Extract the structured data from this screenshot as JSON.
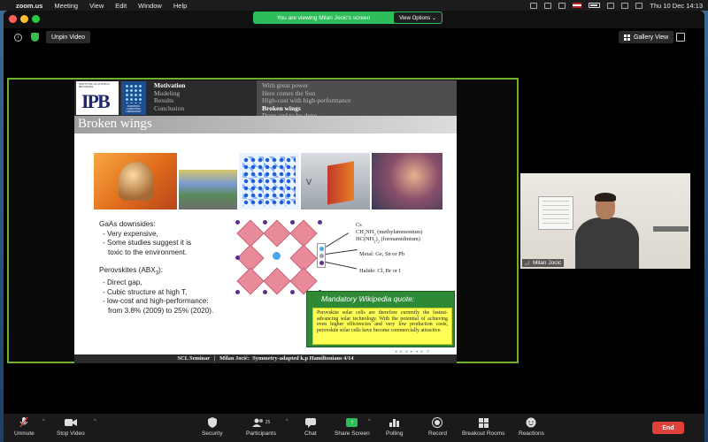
{
  "menubar": {
    "app": "zoom.us",
    "items": [
      "Meeting",
      "View",
      "Edit",
      "Window",
      "Help"
    ],
    "clock": "Thu 10 Dec  14:13"
  },
  "banner": {
    "message": "You are viewing Milan Jocic's screen",
    "view_options": "View Options ⌄"
  },
  "topbar": {
    "unpin": "Unpin Video",
    "gallery": "Gallery View"
  },
  "slide": {
    "logo_small": "INSTITUTE OF PHYSICS BELGRADE",
    "logo_big": "IPB",
    "lab_logo": "SCIENTIFIC COMPUTING LABORATORY",
    "nav_left": [
      "Motivation",
      "Modeling",
      "Results",
      "Conclusion"
    ],
    "nav_right": [
      "With great power",
      "Here comes the Sun",
      "High-cost with high-performance",
      "Broken wings",
      "Done and to be done"
    ],
    "title": "Broken wings",
    "gaas_title": "GaAs downsides:",
    "gaas_1": "- Very expensive,",
    "gaas_2": "- Some studies suggest it is",
    "gaas_3": "toxic to the environment.",
    "pero_title": "Perovskites (ABX",
    "pero_title_sub": "3",
    "pero_title_end": "):",
    "pero_1": "- Direct gap,",
    "pero_2": "- Cubic structure at high T,",
    "pero_3": "- low-cost and high-performance:",
    "pero_4": "from 3.8% (2009) to 25% (2020).",
    "label_a1": "Cs",
    "label_a2": "CH",
    "label_a2_sub1": "3",
    "label_a2_mid": "NH",
    "label_a2_sub2": "3",
    "label_a2_end": " (methylammonium)",
    "label_a3": "HC(NH",
    "label_a3_sub1": "2",
    "label_a3_mid": ")",
    "label_a3_sub2": "2",
    "label_a3_end": " (formamidinium)",
    "label_b": "Metal: Ge, Sn or Pb",
    "label_x": "Halide: Cl, Br or I",
    "device_v": "V",
    "quote_title": "Mandatory Wikipedia quote:",
    "quote_body": "Perovskite solar cells are therefore currently the fastest-advancing solar technology. With the potential of achieving even higher efficiencies and very low production costs, perovskite solar cells have become commercially attractive.",
    "footer": "SCL Seminar   |   Milan Jocić:  Symmetry-adapted k.p Hamiltonians 4/14"
  },
  "participant": {
    "name": "Milan Jocic"
  },
  "toolbar": {
    "unmute": "Unmute",
    "stop_video": "Stop Video",
    "security": "Security",
    "participants": "Participants",
    "participants_count": "25",
    "chat": "Chat",
    "share_screen": "Share Screen",
    "polling": "Polling",
    "record": "Record",
    "breakout": "Breakout Rooms",
    "reactions": "Reactions",
    "end": "End"
  }
}
